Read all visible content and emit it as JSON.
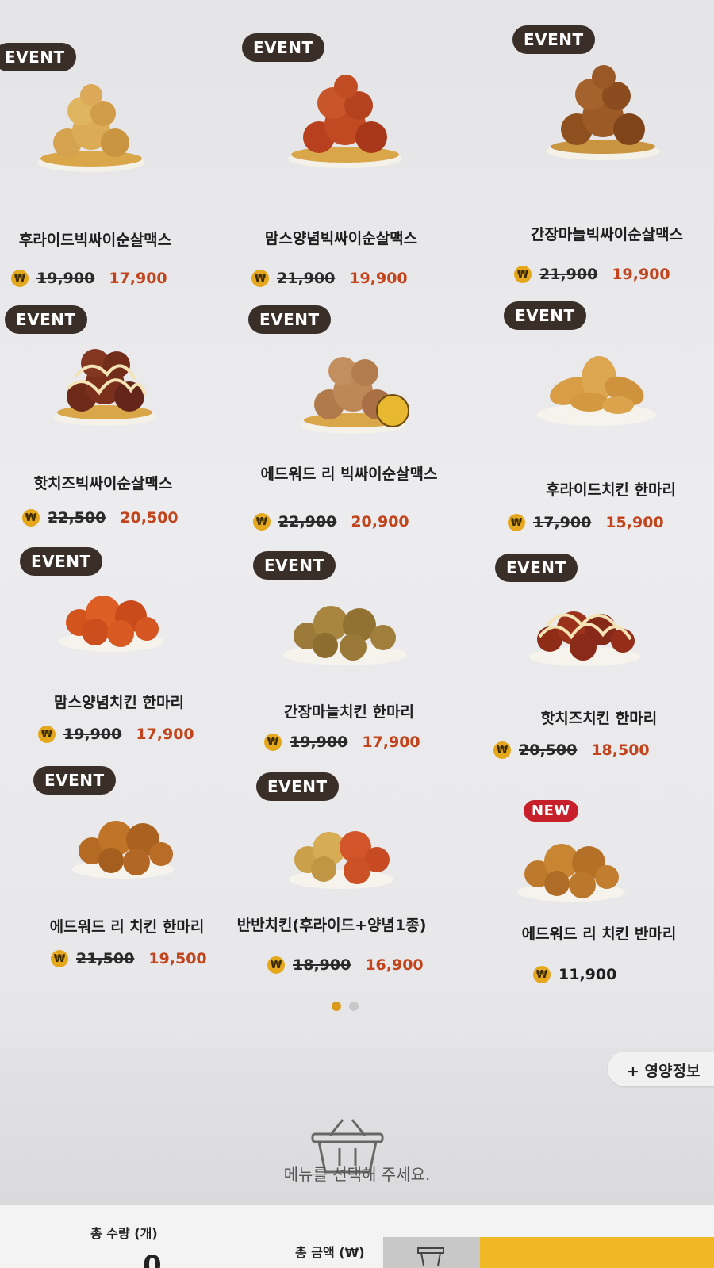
{
  "event_label": "EVENT",
  "new_label": "NEW",
  "currency_symbol": "₩",
  "items": [
    {
      "name": "후라이드빅싸이순살맥스",
      "old_price": "19,900",
      "price": "17,900",
      "badge": "EVENT"
    },
    {
      "name": "맘스양념빅싸이순살맥스",
      "old_price": "21,900",
      "price": "19,900",
      "badge": "EVENT"
    },
    {
      "name": "간장마늘빅싸이순살맥스",
      "old_price": "21,900",
      "price": "19,900",
      "badge": "EVENT"
    },
    {
      "name": "핫치즈빅싸이순살맥스",
      "old_price": "22,500",
      "price": "20,500",
      "badge": "EVENT"
    },
    {
      "name": "에드워드 리 빅싸이순살맥스",
      "old_price": "22,900",
      "price": "20,900",
      "badge": "EVENT"
    },
    {
      "name": "후라이드치킨 한마리",
      "old_price": "17,900",
      "price": "15,900",
      "badge": "EVENT"
    },
    {
      "name": "맘스양념치킨 한마리",
      "old_price": "19,900",
      "price": "17,900",
      "badge": "EVENT"
    },
    {
      "name": "간장마늘치킨 한마리",
      "old_price": "19,900",
      "price": "17,900",
      "badge": "EVENT"
    },
    {
      "name": "핫치즈치킨 한마리",
      "old_price": "20,500",
      "price": "18,500",
      "badge": "EVENT"
    },
    {
      "name": "에드워드 리 치킨 한마리",
      "old_price": "21,500",
      "price": "19,500",
      "badge": "EVENT"
    },
    {
      "name": "반반치킨(후라이드+양념1종)",
      "old_price": "18,900",
      "price": "16,900",
      "badge": "EVENT"
    },
    {
      "name": "에드워드 리 치킨 반마리",
      "old_price": "",
      "price": "11,900",
      "badge": "NEW"
    }
  ],
  "nutrition_button": "+ 영양정보",
  "cart": {
    "empty_message": "메뉴를 선택해 주세요.",
    "total_qty_label": "총 수량 (개)",
    "total_qty_value": "0",
    "total_amount_label": "총 금액 (₩)"
  },
  "colors": {
    "badge_event": "#3a2e29",
    "badge_new": "#c8202a",
    "price_sale": "#c2441c",
    "won_coin": "#e5a71b",
    "page_dot_active": "#d99a1e",
    "order_button": "#f0b824"
  },
  "page_indicator": {
    "pages": 2,
    "active": 1
  }
}
